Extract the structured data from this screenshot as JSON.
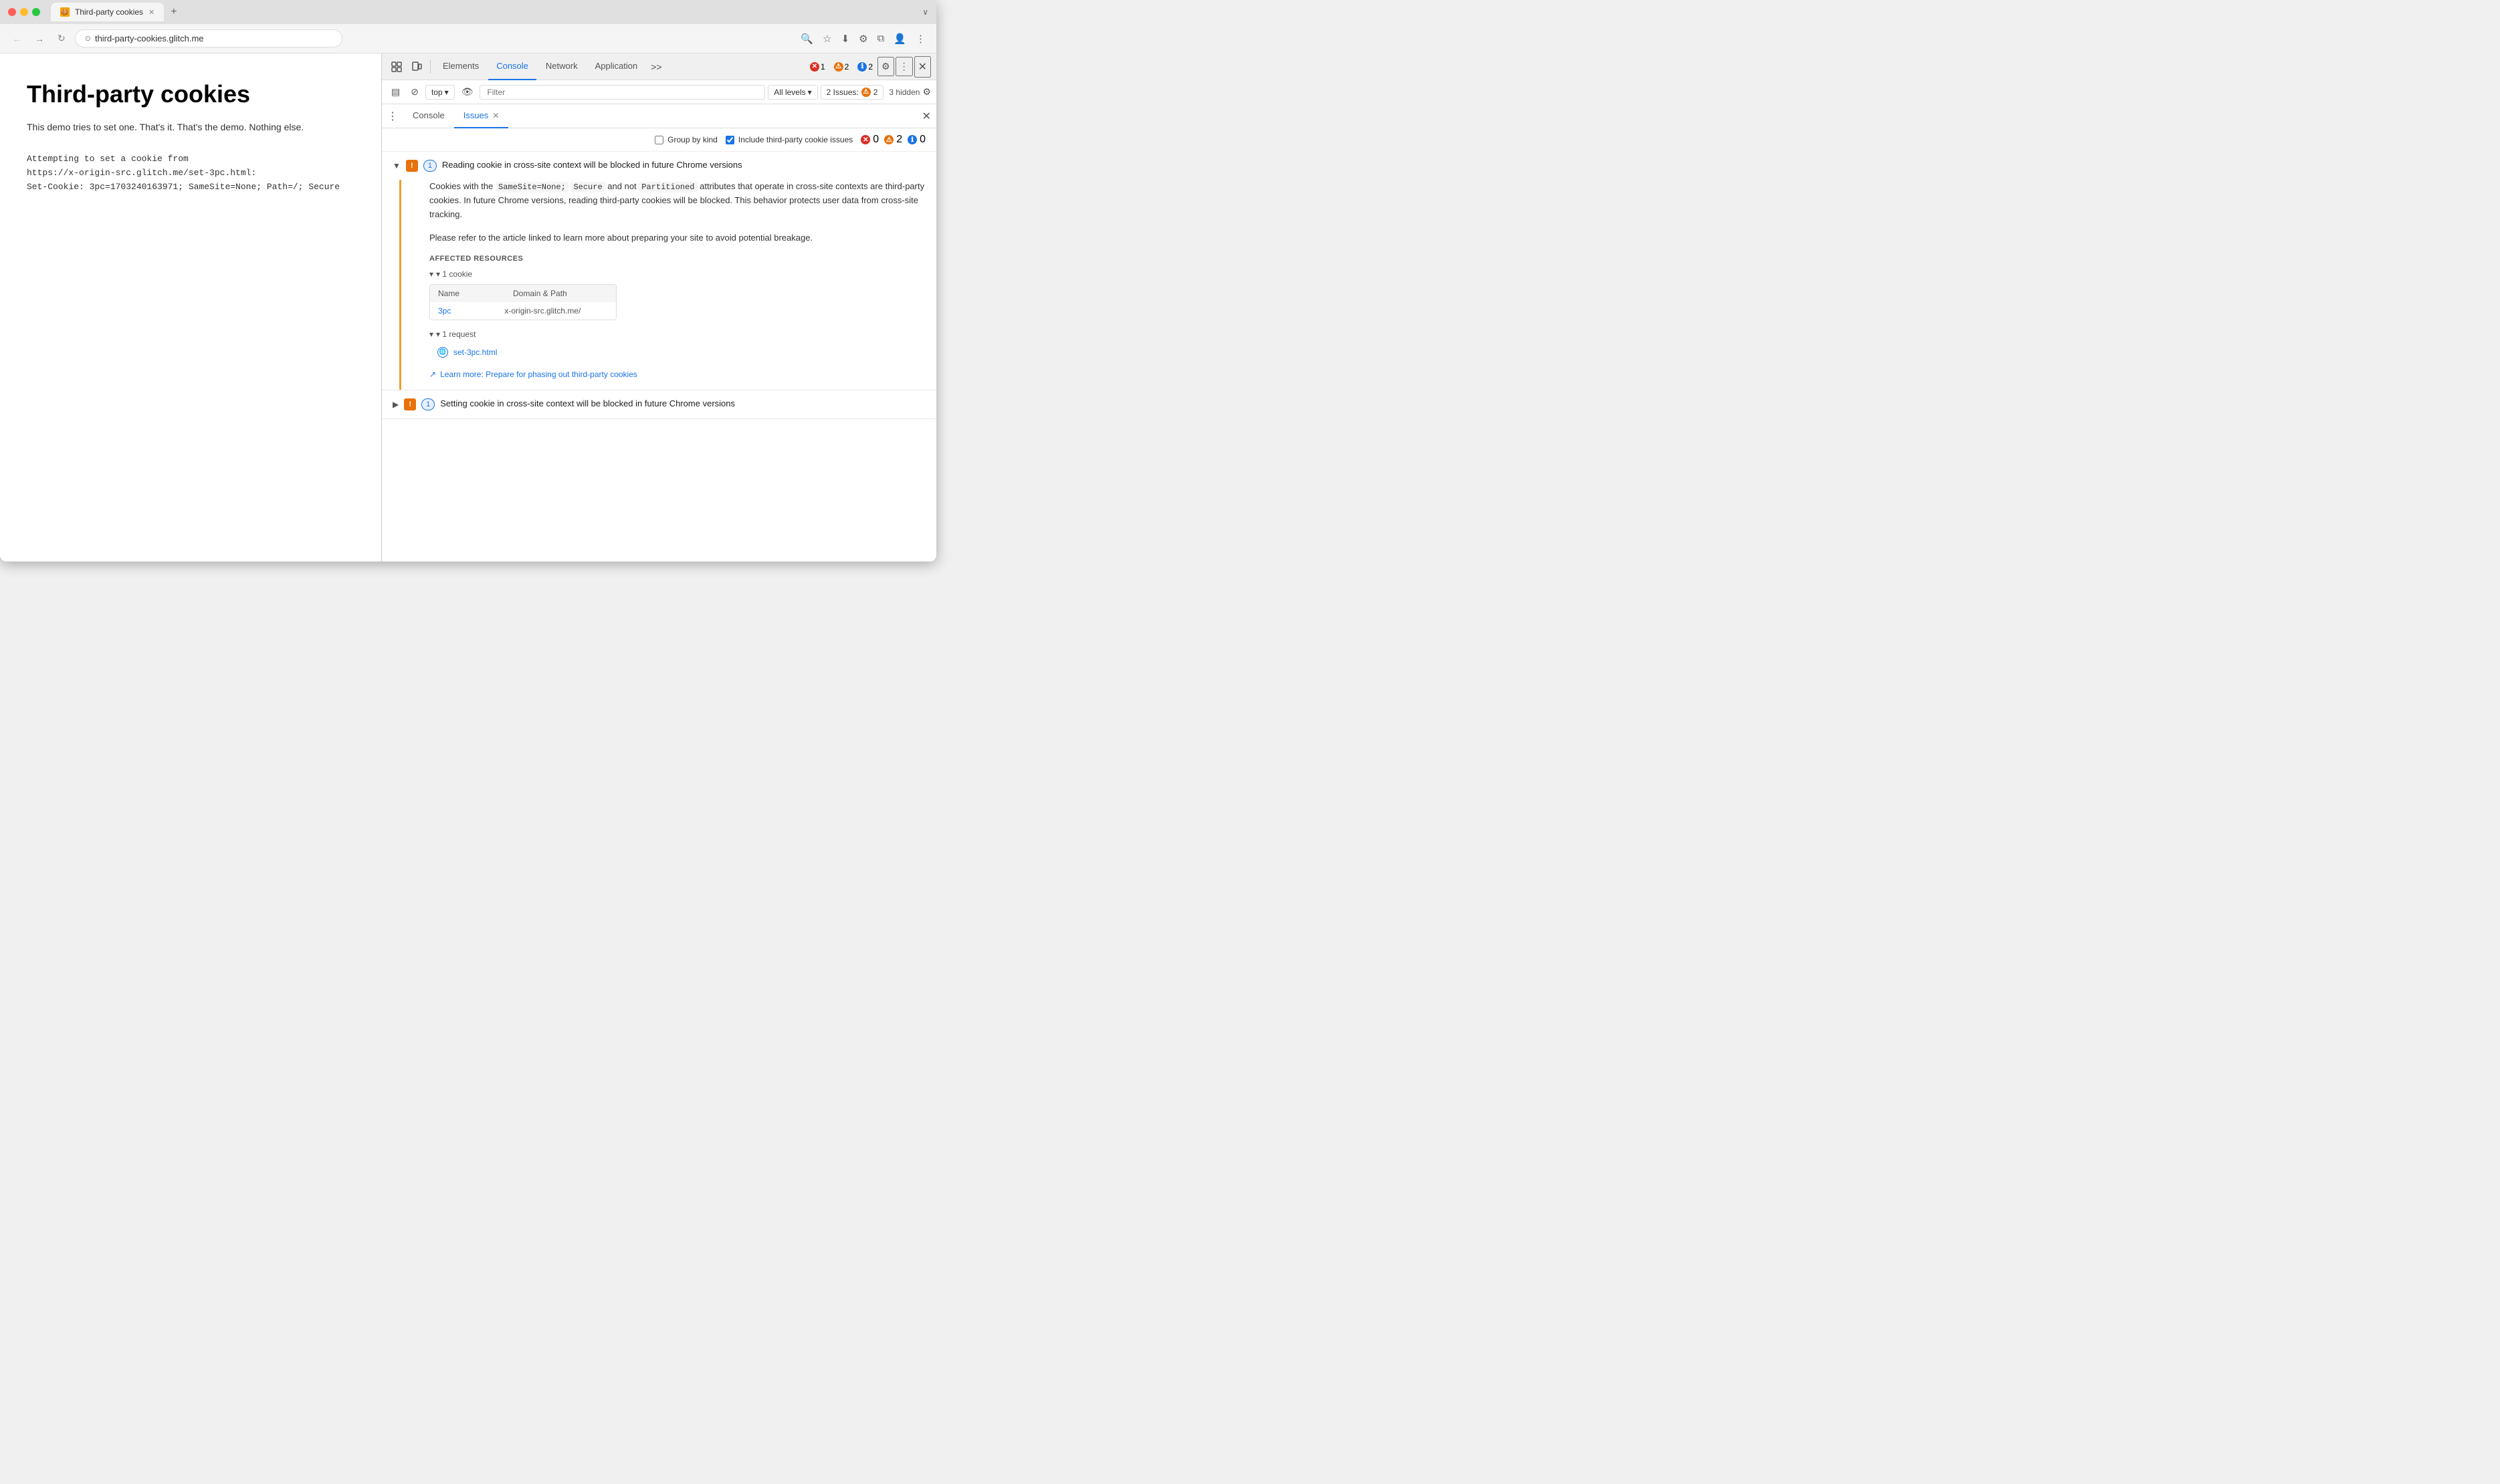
{
  "browser": {
    "tab_title": "Third-party cookies",
    "tab_favicon_color": "#f0a500",
    "url": "third-party-cookies.glitch.me",
    "new_tab_label": "+",
    "expand_label": "∨"
  },
  "nav": {
    "back_label": "←",
    "forward_label": "→",
    "refresh_label": "↻",
    "address_scheme": "⊙",
    "search_icon": "🔍",
    "star_icon": "☆",
    "download_icon": "⬇",
    "extensions_icon": "⚙",
    "profile_icon": "👤",
    "menu_icon": "⋮"
  },
  "page": {
    "title": "Third-party cookies",
    "subtitle": "This demo tries to set one. That's it. That's the demo. Nothing else.",
    "log_line1": "Attempting to set a cookie from",
    "log_line2": "https://x-origin-src.glitch.me/set-3pc.html:",
    "log_line3": "Set-Cookie: 3pc=1703240163971; SameSite=None; Path=/; Secure"
  },
  "devtools": {
    "icon_selector": "⋮⋮",
    "icon_device": "□",
    "tabs": [
      {
        "label": "Elements",
        "active": false
      },
      {
        "label": "Console",
        "active": false
      },
      {
        "label": "Network",
        "active": false
      },
      {
        "label": "Application",
        "active": false
      }
    ],
    "more_tabs": ">>",
    "errors": {
      "red_count": "1",
      "orange_count": "2",
      "blue_count": "2"
    },
    "settings_icon": "⚙",
    "more_icon": "⋮",
    "close_icon": "✕"
  },
  "console_toolbar": {
    "sidebar_icon": "▤",
    "block_icon": "⊘",
    "context_label": "top",
    "context_dropdown": "▾",
    "eye_icon": "👁",
    "filter_placeholder": "Filter",
    "levels_label": "All levels",
    "levels_dropdown": "▾",
    "issues_label": "2 Issues:",
    "issues_count": "2",
    "hidden_label": "3 hidden",
    "gear_icon": "⚙"
  },
  "issues_panel": {
    "menu_icon": "⋮",
    "tabs": [
      {
        "label": "Console",
        "active": false
      },
      {
        "label": "Issues",
        "active": true
      }
    ],
    "close_icon": "✕",
    "group_by_kind_label": "Group by kind",
    "include_third_party_label": "Include third-party cookie issues",
    "third_party_checked": true,
    "counts": {
      "red": "0",
      "orange": "2",
      "blue": "0"
    },
    "issues": [
      {
        "id": "issue1",
        "expanded": true,
        "warning_icon": "!",
        "count": "1",
        "title": "Reading cookie in cross-site context will be blocked in future Chrome versions",
        "description1": "Cookies with the",
        "code1": "SameSite=None;",
        "description2": "Secure",
        "description3": "and not",
        "code2": "Partitioned",
        "description4": "attributes that operate in cross-site contexts are third-party cookies. In future Chrome versions, reading third-party cookies will be blocked. This behavior protects user data from cross-site tracking.",
        "description5": "Please refer to the article linked to learn more about preparing your site to avoid potential breakage.",
        "affected_resources_title": "AFFECTED RESOURCES",
        "cookie_section": {
          "label": "▾ 1 cookie",
          "table_headers": [
            "Name",
            "Domain & Path"
          ],
          "rows": [
            {
              "name": "3pc",
              "domain": "x-origin-src.glitch.me/"
            }
          ]
        },
        "request_section": {
          "label": "▾ 1 request",
          "items": [
            {
              "label": "set-3pc.html"
            }
          ]
        },
        "learn_more": {
          "icon": "↗",
          "label": "Learn more: Prepare for phasing out third-party cookies",
          "url": "#"
        }
      },
      {
        "id": "issue2",
        "expanded": false,
        "warning_icon": "!",
        "count": "1",
        "title": "Setting cookie in cross-site context will be blocked in future Chrome versions"
      }
    ]
  }
}
